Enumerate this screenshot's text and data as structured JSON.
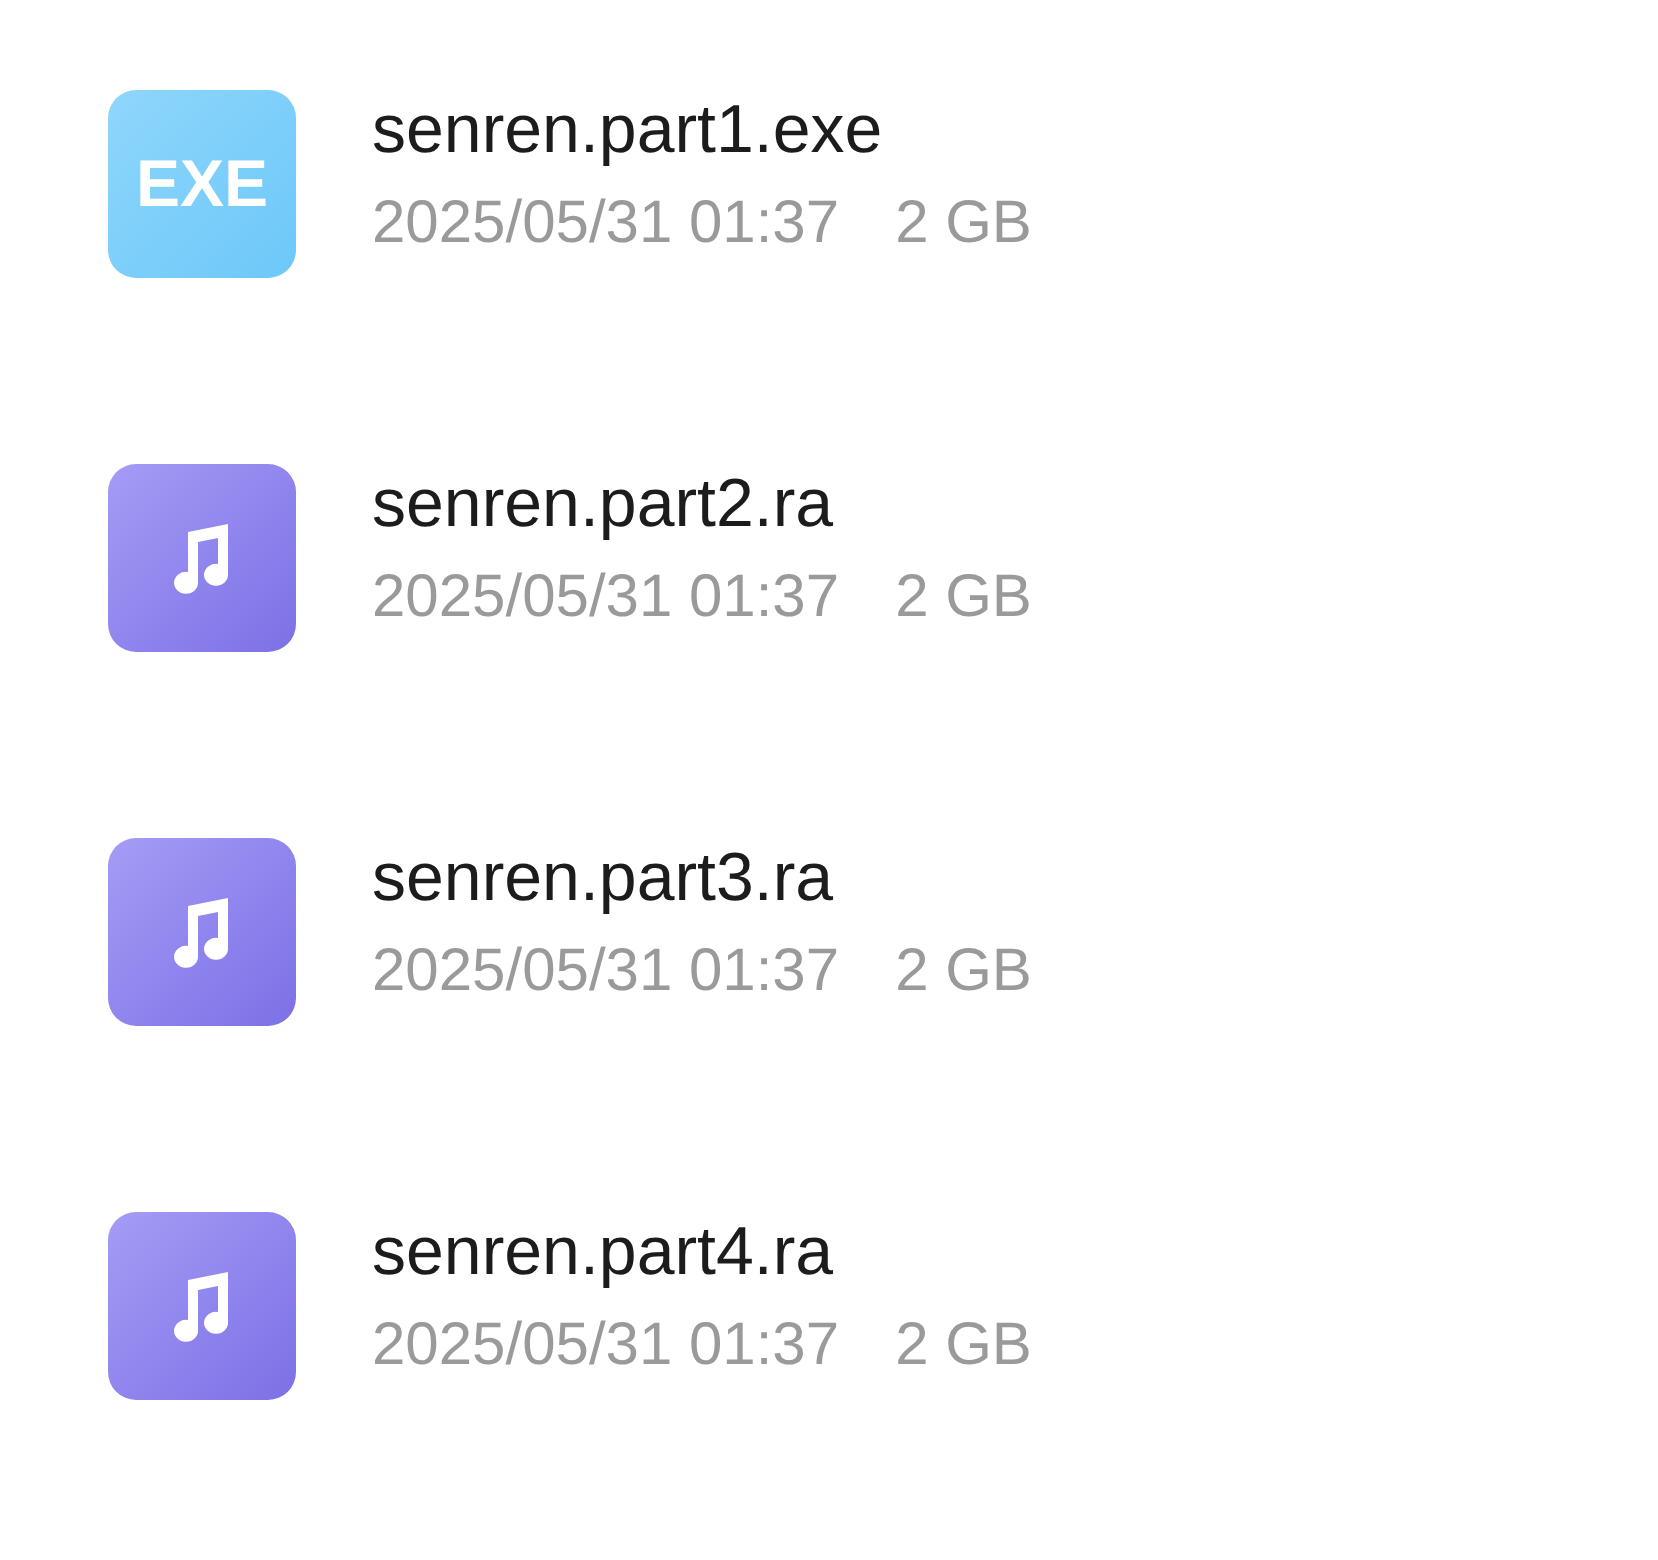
{
  "files": [
    {
      "kind": "exe",
      "icon_label": "EXE",
      "name": "senren.part1.exe",
      "date": "2025/05/31 01:37",
      "size": "2 GB"
    },
    {
      "kind": "audio",
      "name": "senren.part2.ra",
      "date": "2025/05/31 01:37",
      "size": "2 GB"
    },
    {
      "kind": "audio",
      "name": "senren.part3.ra",
      "date": "2025/05/31 01:37",
      "size": "2 GB"
    },
    {
      "kind": "audio",
      "name": "senren.part4.ra",
      "date": "2025/05/31 01:37",
      "size": "2 GB"
    }
  ]
}
